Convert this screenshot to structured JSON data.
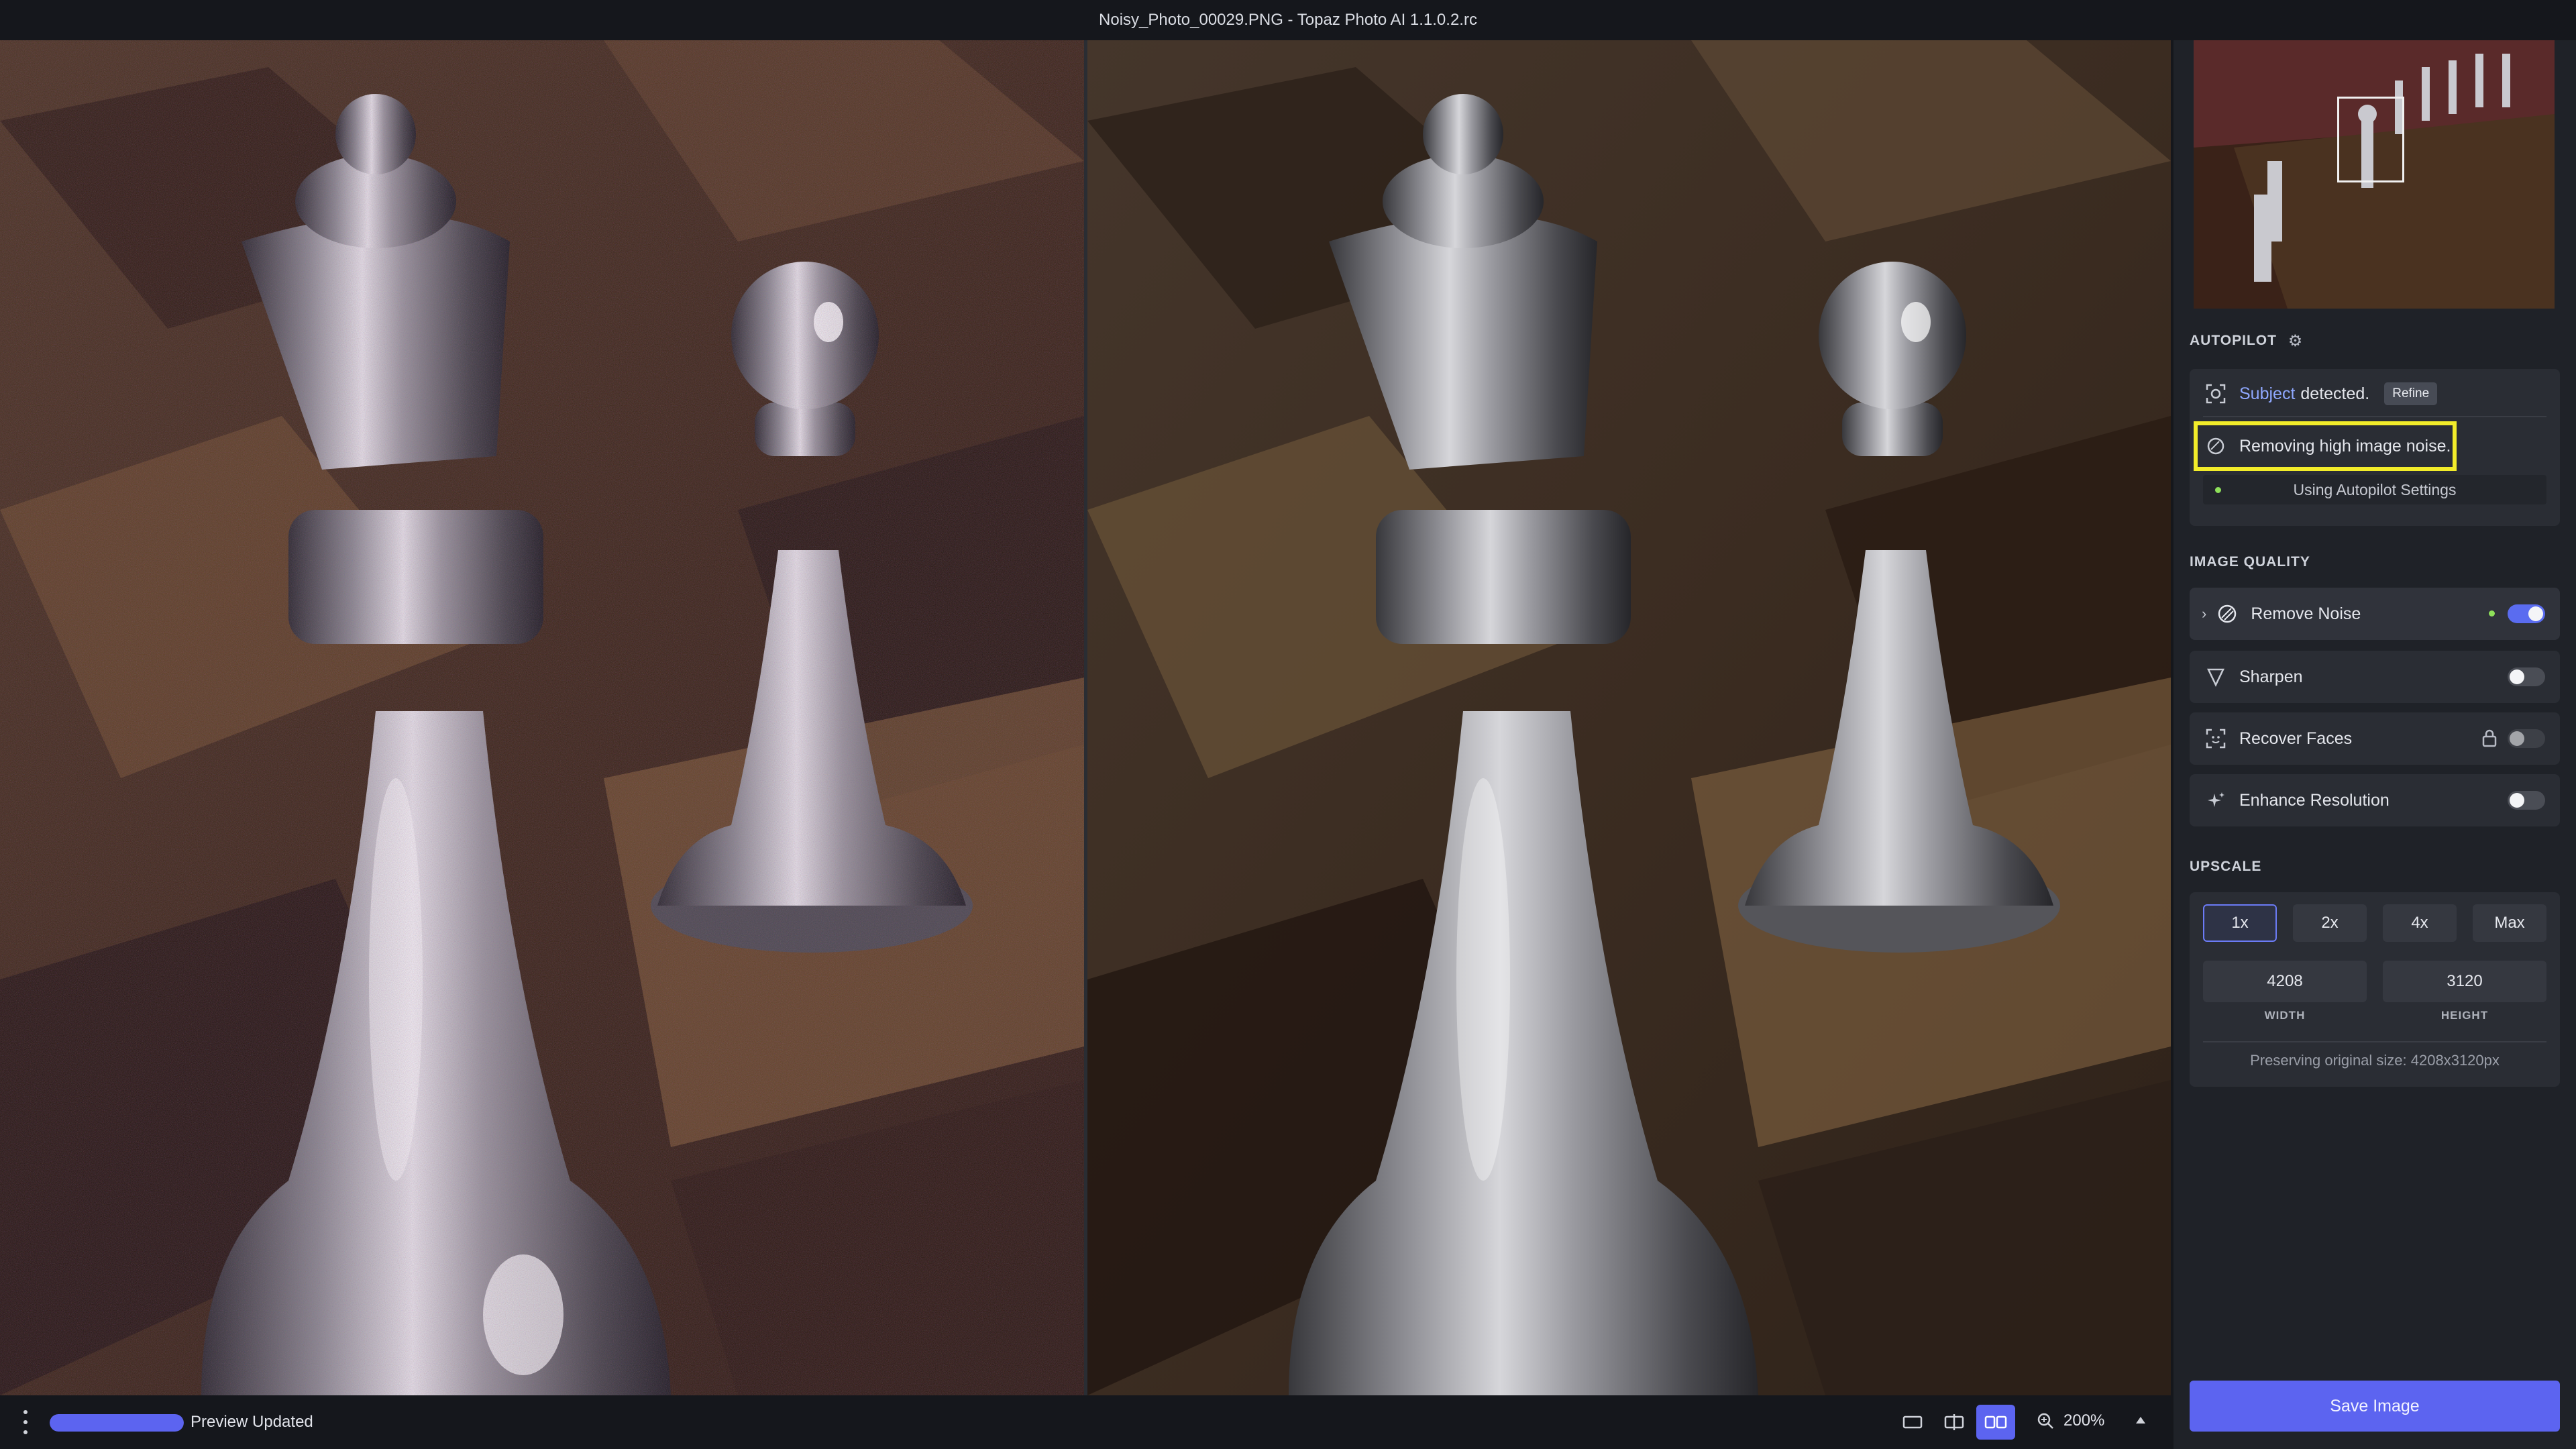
{
  "window": {
    "title": "Noisy_Photo_00029.PNG - Topaz Photo AI 1.1.0.2.rc"
  },
  "autopilot": {
    "title": "AUTOPILOT",
    "subject_word": "Subject",
    "subject_rest": "detected.",
    "refine_label": "Refine",
    "noise_message": "Removing high image noise.",
    "settings_label": "Using Autopilot Settings"
  },
  "image_quality": {
    "title": "IMAGE QUALITY",
    "items": [
      {
        "label": "Remove Noise",
        "icon": "remove-noise-icon",
        "enabled": true
      },
      {
        "label": "Sharpen",
        "icon": "sharpen-icon",
        "enabled": false
      },
      {
        "label": "Recover Faces",
        "icon": "recover-faces-icon",
        "enabled": false,
        "locked": true
      },
      {
        "label": "Enhance Resolution",
        "icon": "enhance-resolution-icon",
        "enabled": false
      }
    ]
  },
  "upscale": {
    "title": "UPSCALE",
    "options": [
      "1x",
      "2x",
      "4x",
      "Max"
    ],
    "selected": "1x",
    "width": "4208",
    "height": "3120",
    "width_label": "WIDTH",
    "height_label": "HEIGHT",
    "note": "Preserving original size: 4208x3120px"
  },
  "save_label": "Save Image",
  "status": {
    "text": "Preview Updated",
    "progress": 1.0
  },
  "zoom": "200%",
  "colors": {
    "accent": "#5c64f0",
    "highlight": "#f2ec2a",
    "active_dot": "#8ee05a"
  }
}
